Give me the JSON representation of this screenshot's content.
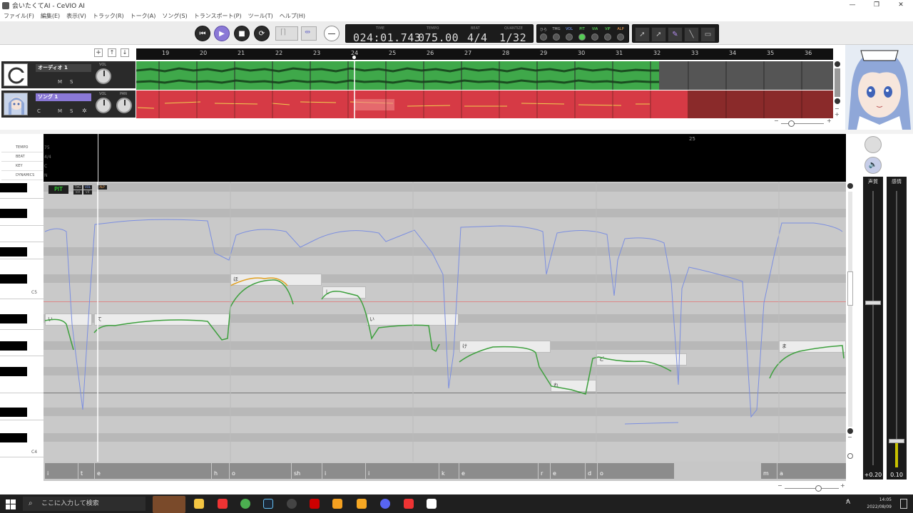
{
  "window": {
    "title": "会いたくてAI - CeVIO AI",
    "controls": [
      "—",
      "❐",
      "✕"
    ]
  },
  "menu": [
    "ファイル(F)",
    "編集(E)",
    "表示(V)",
    "トラック(R)",
    "トーク(A)",
    "ソング(S)",
    "トランスポート(P)",
    "ツール(T)",
    "ヘルプ(H)"
  ],
  "transport": {
    "time_label": "TIME",
    "time": "024:01.743",
    "tempo_label": "TEMPO",
    "tempo": "075.00",
    "beat_label": "BEAT",
    "beat": "4/4",
    "quantize_label": "QUANTIZE",
    "quantize": "1/32",
    "toggles": [
      "ひら",
      "TMG",
      "VOL",
      "PIT",
      "VIA",
      "VIF",
      "ALP"
    ]
  },
  "ruler": [
    "19",
    "20",
    "21",
    "22",
    "23",
    "24",
    "25",
    "26",
    "27",
    "28",
    "29",
    "30",
    "31",
    "32",
    "33",
    "34",
    "35",
    "36"
  ],
  "tracks": [
    {
      "name": "オーディオ 1",
      "m": "M",
      "s": "S",
      "vol_label": "VOL"
    },
    {
      "name": "ソング 1",
      "c": "C",
      "m": "M",
      "s": "S",
      "vol_label": "VOL",
      "pan_label": "PAN"
    }
  ],
  "params": {
    "labels": [
      "TEMPO",
      "BEAT",
      "KEY",
      "DYNAMICS"
    ],
    "values": [
      "75",
      "4/4",
      "C",
      "N"
    ],
    "measure": "25"
  },
  "piano": {
    "c5": "C5",
    "c4": "C4"
  },
  "editor_tabs": {
    "pit": "PIT",
    "small": [
      "TMG",
      "VOL",
      "ALP",
      "VIA",
      "VIF"
    ]
  },
  "notes": [
    {
      "lyric": "い"
    },
    {
      "lyric": "て"
    },
    {
      "lyric": "ほ"
    },
    {
      "lyric": "し"
    },
    {
      "lyric": "い"
    },
    {
      "lyric": "け"
    },
    {
      "lyric": "れ"
    },
    {
      "lyric": "ど"
    },
    {
      "lyric": "ま"
    }
  ],
  "phonemes": [
    "i",
    "t",
    "e",
    "h",
    "o",
    "sh",
    "i",
    "i",
    "k",
    "e",
    "r",
    "e",
    "d",
    "o",
    "m",
    "a"
  ],
  "mixer": {
    "ch1_label": "声質",
    "ch1_value": "+0.20",
    "ch2_label": "感情",
    "ch2_value": "0.10"
  },
  "taskbar": {
    "search_placeholder": "ここに入力して検索",
    "time": "14:05",
    "date": "2022/08/09",
    "ime": "A"
  }
}
